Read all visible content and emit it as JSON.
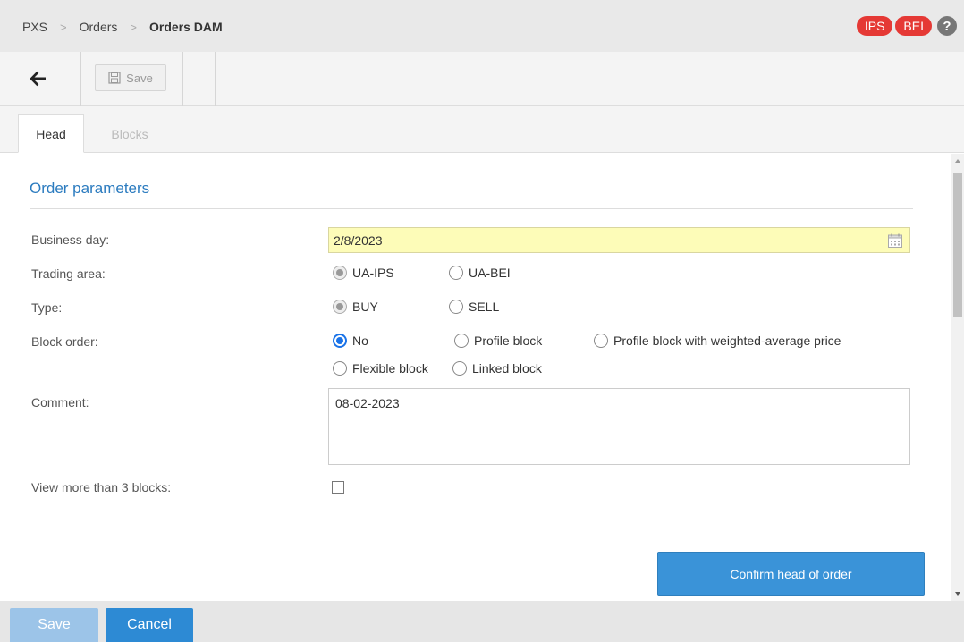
{
  "breadcrumb": [
    "PXS",
    "Orders",
    "Orders DAM"
  ],
  "header": {
    "badges": [
      "IPS",
      "BEI"
    ],
    "help": "?"
  },
  "toolbar": {
    "save_label": "Save"
  },
  "tabs": [
    {
      "label": "Head",
      "active": true
    },
    {
      "label": "Blocks",
      "active": false
    }
  ],
  "form": {
    "section_title": "Order parameters",
    "business_day": {
      "label": "Business day:",
      "value": "2/8/2023"
    },
    "trading_area": {
      "label": "Trading area:",
      "options": [
        "UA-IPS",
        "UA-BEI"
      ],
      "selected": "UA-IPS"
    },
    "type": {
      "label": "Type:",
      "options": [
        "BUY",
        "SELL"
      ],
      "selected": "BUY"
    },
    "block_order": {
      "label": "Block order:",
      "options": [
        "No",
        "Profile block",
        "Profile block with weighted-average price",
        "Flexible block",
        "Linked block"
      ],
      "selected": "No"
    },
    "comment": {
      "label": "Comment:",
      "value": "08-02-2023"
    },
    "view_more": {
      "label": "View more than 3 blocks:",
      "checked": false
    },
    "confirm_label": "Confirm head of order"
  },
  "footer": {
    "save_label": "Save",
    "cancel_label": "Cancel"
  }
}
